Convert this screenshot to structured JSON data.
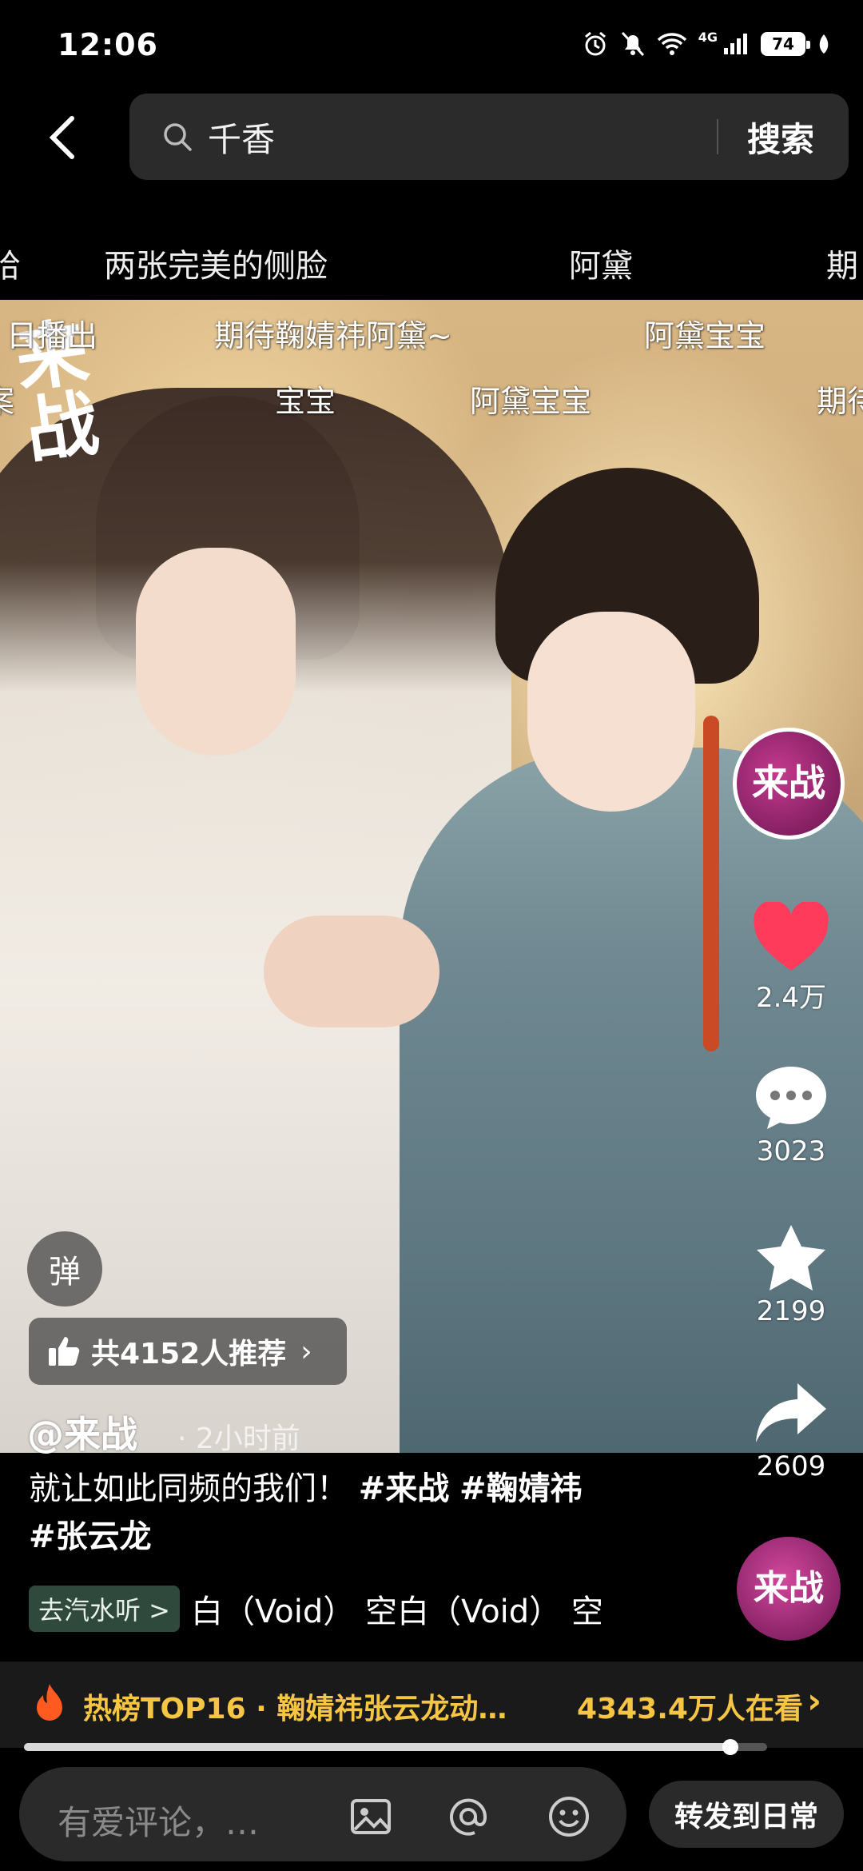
{
  "status_bar": {
    "time": "12:06",
    "network": "4G",
    "battery": "74"
  },
  "search": {
    "query": "千香",
    "button_label": "搜索"
  },
  "related_searches": [
    "哈",
    "两张完美的侧脸",
    "阿黛",
    "期"
  ],
  "video": {
    "logo_text": "来战",
    "logo_subtitle": "日播出",
    "danmaku": [
      "日播出",
      "期待鞠婧祎阿黛~",
      "阿黛宝宝",
      "案",
      "宝宝",
      "阿黛宝宝",
      "期待"
    ],
    "danmaku_toggle": "弹",
    "recommend_label": "共4152人推荐",
    "author": "@来战",
    "posted_time": "· 2小时前"
  },
  "rail": {
    "avatar_text": "来战",
    "like_count": "2.4万",
    "comment_count": "3023",
    "favorite_count": "2199",
    "share_count": "2609"
  },
  "caption": {
    "text": "就让如此同频的我们！",
    "tags": [
      "#来战",
      "#鞠婧祎",
      "#张云龙"
    ]
  },
  "music": {
    "chip_label": "去汽水听 >",
    "title": "白（Void）    空白（Void）    空",
    "disc_text": "来战"
  },
  "hot": {
    "title": "热榜TOP16 · 鞠婧祎张云龙动…",
    "views": "4343.4万人在看",
    "chevron": "›"
  },
  "progress": {
    "fraction": 0.95
  },
  "comment_bar": {
    "placeholder": "有爱评论，…"
  },
  "share_button": {
    "label": "转发到日常"
  },
  "colors": {
    "accent_yellow": "#f6c544",
    "like_red": "#ff3b5c",
    "music_chip_bg": "#2f4a3c"
  }
}
